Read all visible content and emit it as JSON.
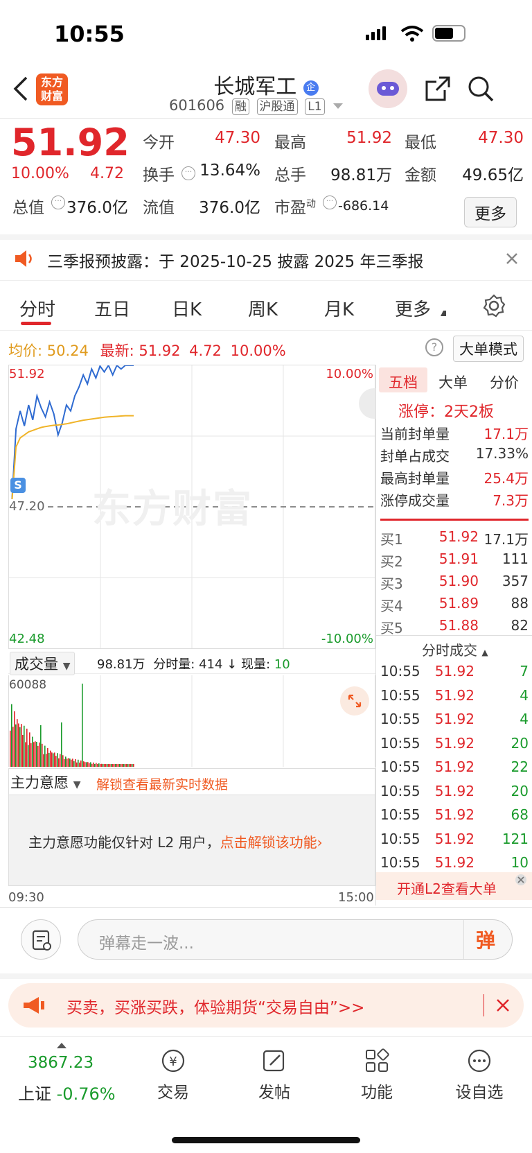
{
  "status": {
    "time": "10:55"
  },
  "header": {
    "logo": "东方财富",
    "name": "长城军工",
    "code": "601606",
    "badges": [
      "融",
      "沪股通",
      "L1"
    ]
  },
  "quote": {
    "price": "51.92",
    "pct": "10.00%",
    "chg": "4.72",
    "open_label": "今开",
    "open": "47.30",
    "high_label": "最高",
    "high": "51.92",
    "low_label": "最低",
    "low": "47.30",
    "turnover_label": "换手",
    "turnover": "13.64%",
    "volume_label": "总手",
    "volume": "98.81万",
    "amount_label": "金额",
    "amount": "49.65亿",
    "mcap_label": "总值",
    "mcap": "376.0亿",
    "float_label": "流值",
    "float": "376.0亿",
    "pe_label": "市盈",
    "pe_sup": "动",
    "pe": "-686.14",
    "more": "更多"
  },
  "notice": {
    "text": "三季报预披露：于 2025-10-25 披露 2025 年三季报"
  },
  "tabs": [
    "分时",
    "五日",
    "日K",
    "周K",
    "月K",
    "更多"
  ],
  "info_bar": {
    "avg_label": "均价:",
    "avg": "50.24",
    "latest_label": "最新:",
    "latest": "51.92",
    "chg": "4.72",
    "pct": "10.00%",
    "mode": "大单模式"
  },
  "chart": {
    "top_left": "51.92",
    "top_right": "10.00%",
    "mid": "47.20",
    "bot_left": "42.48",
    "bot_right": "-10.00%",
    "watermark": "东方财富",
    "time_start": "09:30",
    "time_end": "15:00"
  },
  "chart_data": {
    "type": "line",
    "title": "",
    "ylim": [
      42.48,
      51.92
    ],
    "series": [
      {
        "name": "",
        "values": [
          47.3,
          49.8,
          50.4,
          49.9,
          50.6,
          50.1,
          50.9,
          50.5,
          50.2,
          50.7,
          50.3,
          49.6,
          50.0,
          50.6,
          50.4,
          50.9,
          51.2,
          51.6,
          51.3,
          51.8,
          51.5,
          51.9,
          51.7,
          51.92,
          51.6,
          51.92,
          51.8,
          51.92,
          51.92,
          51.92
        ]
      },
      {
        "name": "",
        "values": [
          47.3,
          49.2,
          49.5,
          49.6,
          49.7,
          49.75,
          49.8,
          49.85,
          49.88,
          49.9,
          49.92,
          49.93,
          49.95,
          49.97,
          50.0,
          50.03,
          50.06,
          50.09,
          50.11,
          50.13,
          50.15,
          50.17,
          50.19,
          50.2,
          50.21,
          50.22,
          50.23,
          50.24,
          50.24,
          50.24
        ]
      }
    ]
  },
  "volume": {
    "label": "成交量",
    "total": "98.81万",
    "slice_label": "分时量:",
    "slice": "414",
    "now_label": "现量:",
    "now": "10",
    "max": "60088"
  },
  "main_force": {
    "label": "主力意愿",
    "link": "解锁查看最新实时数据",
    "msg": "主力意愿功能仅针对 L2 用户，",
    "msg_link": "点击解锁该功能"
  },
  "order_book": {
    "tabs": [
      "五档",
      "大单",
      "分价"
    ],
    "limit": "涨停：2天2板",
    "stats": [
      {
        "k": "当前封单量",
        "v": "17.1万"
      },
      {
        "k": "封单占成交",
        "v": "17.33%"
      },
      {
        "k": "最高封单量",
        "v": "25.4万"
      },
      {
        "k": "涨停成交量",
        "v": "7.3万"
      }
    ],
    "bids": [
      {
        "k": "买1",
        "p": "51.92",
        "q": "17.1万"
      },
      {
        "k": "买2",
        "p": "51.91",
        "q": "111"
      },
      {
        "k": "买3",
        "p": "51.90",
        "q": "357"
      },
      {
        "k": "买4",
        "p": "51.89",
        "q": "88"
      },
      {
        "k": "买5",
        "p": "51.88",
        "q": "82"
      }
    ],
    "ticks_label": "分时成交",
    "ticks": [
      {
        "t": "10:55",
        "p": "51.92",
        "q": "7"
      },
      {
        "t": "10:55",
        "p": "51.92",
        "q": "4"
      },
      {
        "t": "10:55",
        "p": "51.92",
        "q": "4"
      },
      {
        "t": "10:55",
        "p": "51.92",
        "q": "20"
      },
      {
        "t": "10:55",
        "p": "51.92",
        "q": "22"
      },
      {
        "t": "10:55",
        "p": "51.92",
        "q": "20"
      },
      {
        "t": "10:55",
        "p": "51.92",
        "q": "68"
      },
      {
        "t": "10:55",
        "p": "51.92",
        "q": "121"
      },
      {
        "t": "10:55",
        "p": "51.92",
        "q": "10"
      }
    ],
    "l2_promo": "开通L2查看大单"
  },
  "comment": {
    "placeholder": "弹幕走一波...",
    "btn": "弹"
  },
  "ad": {
    "text": "买卖，买涨买跌，体验期货“交易自由”>>"
  },
  "bottom": {
    "index_value": "3867.23",
    "index_name": "上证",
    "index_pct": "-0.76%",
    "items": [
      "交易",
      "发帖",
      "功能",
      "设自选"
    ]
  }
}
